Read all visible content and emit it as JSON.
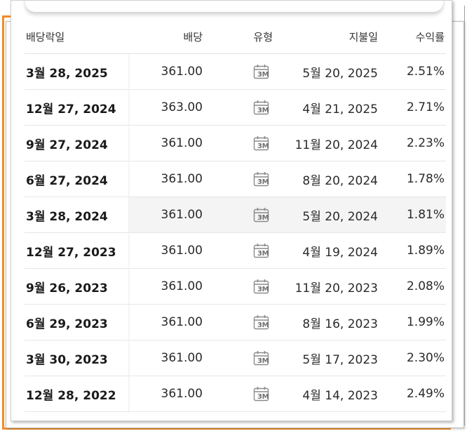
{
  "table": {
    "headers": {
      "ex_date": "배당락일",
      "dividend": "배당",
      "type": "유형",
      "pay_date": "지불일",
      "yield": "수익률"
    },
    "type_icon": {
      "name": "calendar-icon",
      "label": "3M"
    },
    "rows": [
      {
        "ex_date": "3월 28, 2025",
        "dividend": "361.00",
        "pay_date": "5월 20, 2025",
        "yield": "2.51%"
      },
      {
        "ex_date": "12월 27, 2024",
        "dividend": "363.00",
        "pay_date": "4월 21, 2025",
        "yield": "2.71%"
      },
      {
        "ex_date": "9월 27, 2024",
        "dividend": "361.00",
        "pay_date": "11월 20, 2024",
        "yield": "2.23%"
      },
      {
        "ex_date": "6월 27, 2024",
        "dividend": "361.00",
        "pay_date": "8월 20, 2024",
        "yield": "1.78%"
      },
      {
        "ex_date": "3월 28, 2024",
        "dividend": "361.00",
        "pay_date": "5월 20, 2024",
        "yield": "1.81%"
      },
      {
        "ex_date": "12월 27, 2023",
        "dividend": "361.00",
        "pay_date": "4월 19, 2024",
        "yield": "1.89%"
      },
      {
        "ex_date": "9월 26, 2023",
        "dividend": "361.00",
        "pay_date": "11월 20, 2023",
        "yield": "2.08%"
      },
      {
        "ex_date": "6월 29, 2023",
        "dividend": "361.00",
        "pay_date": "8월 16, 2023",
        "yield": "1.99%"
      },
      {
        "ex_date": "3월 30, 2023",
        "dividend": "361.00",
        "pay_date": "5월 17, 2023",
        "yield": "2.30%"
      },
      {
        "ex_date": "12월 28, 2022",
        "dividend": "361.00",
        "pay_date": "4월 14, 2023",
        "yield": "2.49%"
      }
    ]
  },
  "colors": {
    "accent_frame": "#f28c28",
    "hover_row": "#f4f4f4"
  }
}
